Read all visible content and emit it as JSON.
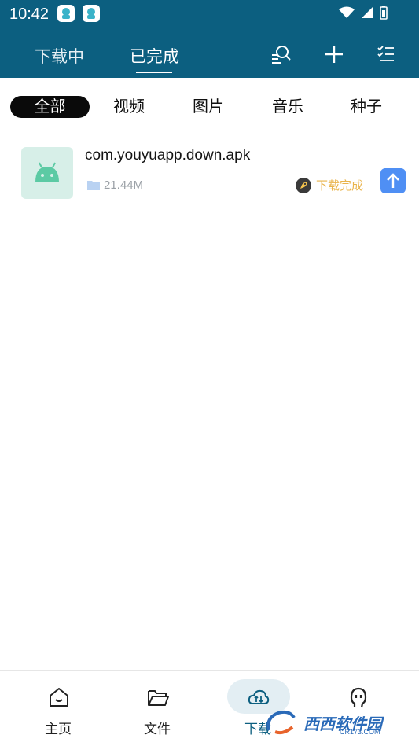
{
  "status_bar": {
    "time": "10:42"
  },
  "header": {
    "tabs": [
      {
        "label": "下载中"
      },
      {
        "label": "已完成"
      }
    ],
    "active_tab": "已完成"
  },
  "filters": [
    {
      "label": "全部"
    },
    {
      "label": "视频"
    },
    {
      "label": "图片"
    },
    {
      "label": "音乐"
    },
    {
      "label": "种子"
    }
  ],
  "downloads": [
    {
      "name": "com.youyuapp.down.apk",
      "size": "21.44M",
      "status": "下载完成"
    }
  ],
  "bottom_nav": [
    {
      "label": "主页"
    },
    {
      "label": "文件"
    },
    {
      "label": "下载"
    }
  ],
  "watermark": {
    "text": "西西软件园",
    "sub": "CR173.COM"
  },
  "colors": {
    "header_bg": "#0c5f80",
    "status_text": "#e9b44c",
    "upload_btn": "#4f8ff4"
  }
}
